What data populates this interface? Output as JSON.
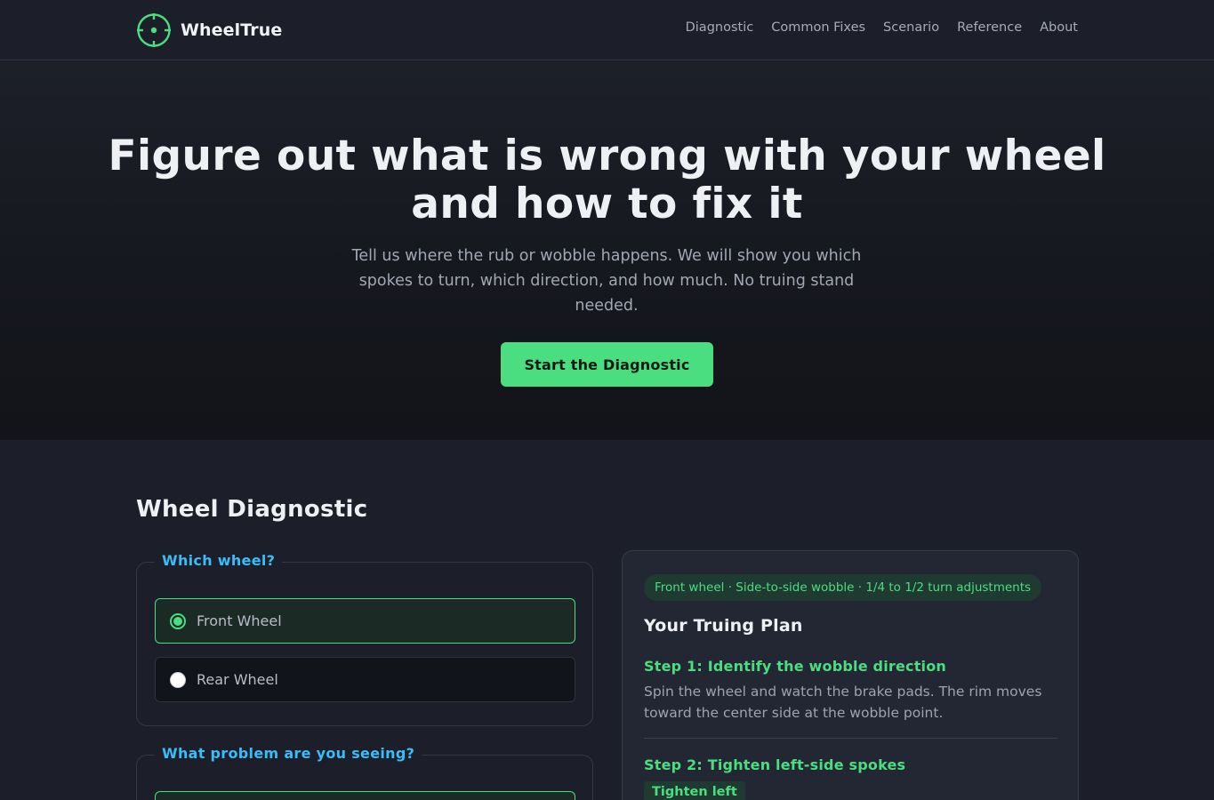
{
  "brand": {
    "name": "WheelTrue",
    "logo_icon": "crosshair-icon",
    "accent": "#4ade80"
  },
  "nav": {
    "links": [
      "Diagnostic",
      "Common Fixes",
      "Scenario",
      "Reference",
      "About"
    ]
  },
  "hero": {
    "title_line1": "Figure out what is wrong with your wheel",
    "title_line2": "and how to fix it",
    "subtitle": "Tell us where the rub or wobble happens. We will show you which spokes to turn, which direction, and how much. No truing stand needed.",
    "cta_label": "Start the Diagnostic"
  },
  "diagnostic": {
    "title": "Wheel Diagnostic",
    "wheel_question": {
      "legend": "Which wheel?",
      "options": [
        {
          "label": "Front Wheel",
          "selected": true
        },
        {
          "label": "Rear Wheel",
          "selected": false
        }
      ]
    },
    "problem_question": {
      "legend": "What problem are you seeing?"
    }
  },
  "plan": {
    "badge": "Front wheel · Side-to-side wobble · 1/4 to 1/2 turn adjustments",
    "title": "Your Truing Plan",
    "steps": [
      {
        "title": "Step 1: Identify the wobble direction",
        "description": "Spin the wheel and watch the brake pads. The rim moves toward the center side at the wobble point."
      },
      {
        "title": "Step 2: Tighten left-side spokes",
        "tag": "Tighten left"
      }
    ]
  }
}
